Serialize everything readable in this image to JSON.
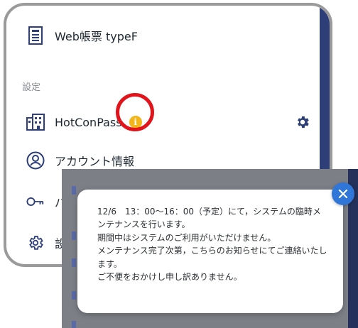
{
  "menu": {
    "top_item": {
      "label": "Web帳票 typeF",
      "icon": "document-icon"
    },
    "section_label": "設定",
    "items": [
      {
        "label": "HotConPass",
        "icon": "building-icon",
        "badge": "i"
      },
      {
        "label": "アカウント情報",
        "icon": "user-circle-icon"
      },
      {
        "label": "パ",
        "icon": "key-icon"
      },
      {
        "label": "設",
        "icon": "gear-icon"
      }
    ]
  },
  "notice": {
    "text": "12/6　13：00～16：00（予定）にて，システムの臨時メンテナンスを行います。\n期間中はシステムのご利用がいただけません。\nメンテナンス完了次第，こちらのお知らせにてご連絡いたします。\nご不便をおかけし申し訳ありません。"
  },
  "colors": {
    "accent": "#2e3f78",
    "badge": "#f2b51c",
    "highlight_ring": "#e0141a",
    "close_button": "#2f76d8",
    "overlay": "#7c7f86"
  }
}
